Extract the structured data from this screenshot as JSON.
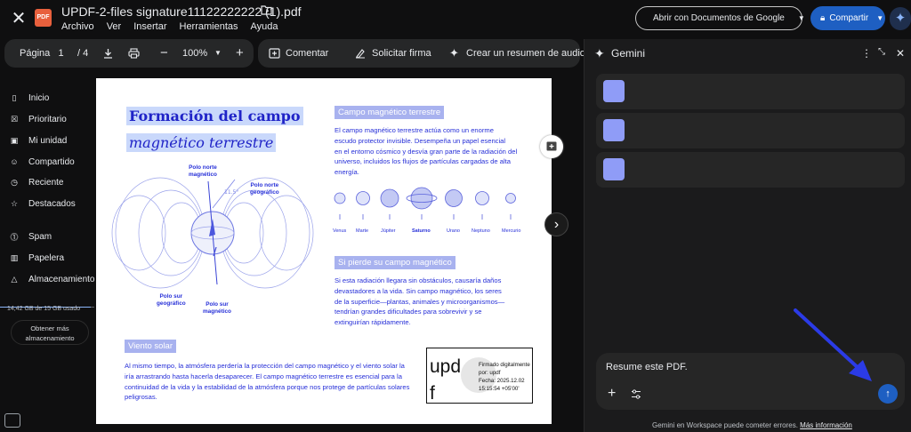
{
  "app": {
    "file_title": "UPDF-2-files signature11122222222 (1).pdf",
    "logo_text": "PDF",
    "menus": [
      "Archivo",
      "Ver",
      "Insertar",
      "Herramientas",
      "Ayuda"
    ],
    "open_with_label": "Abrir con Documentos de Google",
    "share_label": "Compartir"
  },
  "toolbar": {
    "page_label": "Página",
    "page_current": "1",
    "page_total": "/ 4",
    "zoom": "100%",
    "comment_label": "Comentar",
    "sign_label": "Solicitar firma",
    "audio_label": "Crear un resumen de audio"
  },
  "sidebar": {
    "items": [
      {
        "label": "Inicio",
        "icon": "home-icon"
      },
      {
        "label": "Prioritario",
        "icon": "priority-icon"
      },
      {
        "label": "Mi unidad",
        "icon": "drive-icon"
      },
      {
        "label": "Compartido",
        "icon": "people-icon"
      },
      {
        "label": "Reciente",
        "icon": "clock-icon"
      },
      {
        "label": "Destacados",
        "icon": "star-icon"
      },
      {
        "label": "Spam",
        "icon": "spam-icon"
      },
      {
        "label": "Papelera",
        "icon": "trash-icon"
      },
      {
        "label": "Almacenamiento",
        "icon": "cloud-icon"
      }
    ],
    "storage_used_text": "14,42 GB de 15 GB usado",
    "storage_fraction": 0.96,
    "more_storage_line1": "Obtener más",
    "more_storage_line2": "almacenamiento"
  },
  "pdf": {
    "title_line1": "Formación del campo",
    "title_line2": "magnético terrestre",
    "pole_north_mag": [
      "Polo norte",
      "magnético"
    ],
    "pole_north_geo": [
      "Polo norte",
      "geográfico"
    ],
    "pole_south_geo": [
      "Polo sur",
      "geográfico"
    ],
    "pole_south_mag": [
      "Polo sur",
      "magnético"
    ],
    "section1_heading": "Campo magnético terrestre",
    "section1_lines": [
      "El campo magnético terrestre actúa como un enorme",
      "escudo protector invisible. Desempeña un papel esencial",
      "en el entorno cósmico y desvía gran parte de la radiación del",
      "universo, incluidos los flujos de partículas cargadas de alta",
      "energía."
    ],
    "planets": [
      "Venus",
      "Marte",
      "Júpiter",
      "Saturno",
      "Urano",
      "Neptuno",
      "Mercurio"
    ],
    "section2_heading": "Si pierde su campo magnético",
    "section2_lines": [
      "Si esta radiación llegara sin obstáculos, causaría daños",
      "devastadores a la vida. Sin campo magnético, los seres",
      "de la superficie—plantas, animales y microorganismos—",
      "tendrían grandes dificultades para sobrevivir y se",
      "extinguirían rápidamente."
    ],
    "section3_heading": "Viento solar",
    "section3_lines": [
      "Al mismo tiempo, la atmósfera perdería la protección del campo magnético y el viento solar la",
      "iría arrastrando hasta hacerla desaparecer. El campo magnético terrestre es esencial para la",
      "continuidad de la vida y la estabilidad de la atmósfera porque nos protege de partículas solares",
      "peligrosas."
    ],
    "signature": {
      "logo_line1": "upd",
      "logo_line2": "f",
      "lines": [
        "Firmado digitalmente",
        "por: updf",
        "Fecha: 2025.12.02",
        "15:15:54 +05'00'"
      ]
    }
  },
  "gemini": {
    "title": "Gemini",
    "cards": [
      "",
      "",
      ""
    ],
    "input_value": "Resume este PDF.",
    "disclaimer": "Gemini en Workspace puede cometer errores.",
    "disclaimer_link": "Más información"
  },
  "colors": {
    "accent": "#1e5fc2",
    "pdf_text": "#2730d8",
    "highlight": "#c9d8fb",
    "arrow": "#2b3be6"
  }
}
